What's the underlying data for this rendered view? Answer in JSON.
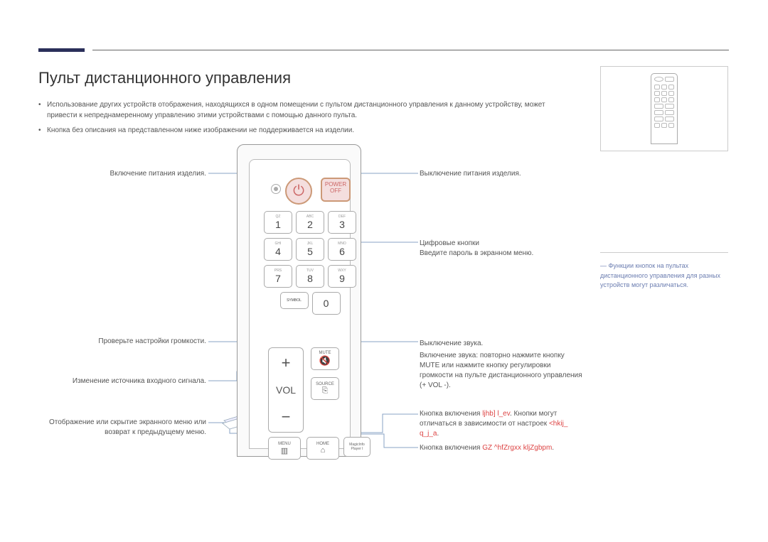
{
  "title": "Пульт дистанционного управления",
  "bullets": [
    "Использование других устройств отображения, находящихся в одном помещении с пультом дистанционного управления к данному устройству, может привести к непреднамеренному управлению этими устройствами с помощью данного пульта.",
    "Кнопка без описания на представленном ниже изображении не поддерживается на изделии."
  ],
  "remote": {
    "power_off": "POWER OFF",
    "keys": [
      [
        {
          "n": "1",
          "s": "QZ"
        },
        {
          "n": "2",
          "s": "ABC"
        },
        {
          "n": "3",
          "s": "DEF"
        }
      ],
      [
        {
          "n": "4",
          "s": "GHI"
        },
        {
          "n": "5",
          "s": "JKL"
        },
        {
          "n": "6",
          "s": "MNO"
        }
      ],
      [
        {
          "n": "7",
          "s": "PRS"
        },
        {
          "n": "8",
          "s": "TUV"
        },
        {
          "n": "9",
          "s": "WXY"
        }
      ]
    ],
    "symbol": "SYMBOL",
    "zero": "0",
    "vol": "VOL",
    "mute": "MUTE",
    "source": "SOURCE",
    "menu": "MENU",
    "home": "HOME",
    "magic": "MagicInfo Player I"
  },
  "left": {
    "l1": "Включение питания изделия.",
    "l2": "Проверьте настройки громкости.",
    "l3": "Изменение источника входного сигнала.",
    "l4": "Отображение или скрытие экранного меню или возврат к предыдущему меню."
  },
  "right": {
    "r1": "Выключение питания изделия.",
    "r2a": "Цифровые кнопки",
    "r2b": "Введите пароль в экранном меню.",
    "r3a": "Выключение звука.",
    "r3b": "Включение звука: повторно нажмите кнопку MUTE или нажмите кнопку регулировки громкости на пульте дистанционного управления (+ VOL -).",
    "r4a": "Кнопка включения ",
    "r4b": "ljhb] l_ev",
    "r4c": ". Кнопки могут отличаться в зависимости от настроек ",
    "r4d": "<hkij_ q_j_a",
    "r4e": ".",
    "r5a": "Кнопка включения ",
    "r5b": "GZ ^hfZrgxx kljZgbpm",
    "r5c": "."
  },
  "sidenote": "Функции кнопок на пультах дистанционного управления для разных устройств могут различаться."
}
